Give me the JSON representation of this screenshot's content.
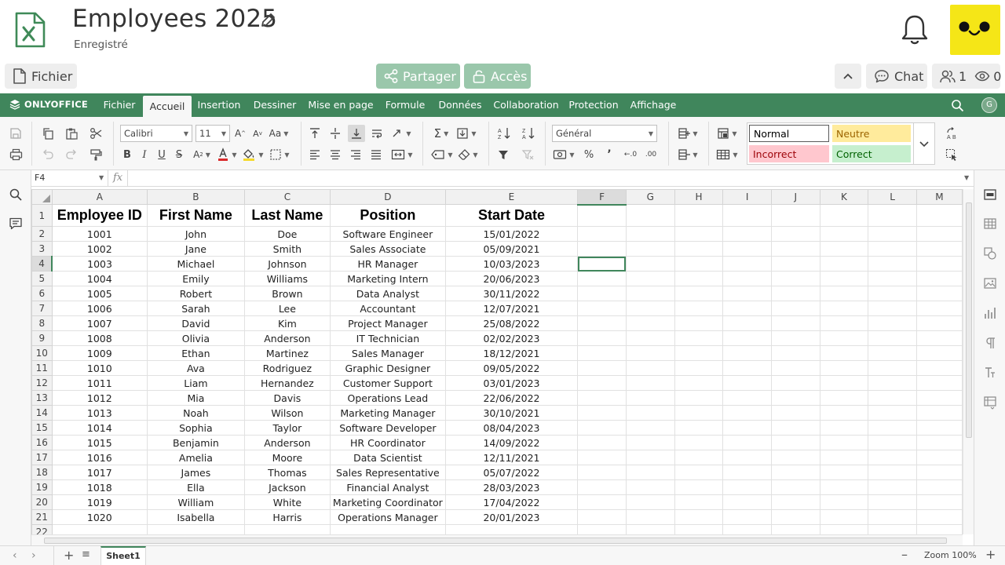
{
  "header": {
    "title": "Employees 2025",
    "saved_status": "Enregistré",
    "file_button": "Fichier",
    "share_button": "Partager",
    "access_button": "Accès",
    "chat_button": "Chat",
    "users_count": "1",
    "viewers_count": "0"
  },
  "tabs": {
    "logo": "ONLYOFFICE",
    "items": [
      "Fichier",
      "Accueil",
      "Insertion",
      "Dessiner",
      "Mise en page",
      "Formule",
      "Données",
      "Collaboration",
      "Protection",
      "Affichage"
    ],
    "active": "Accueil",
    "user_initial": "G"
  },
  "toolbar": {
    "font_name": "Calibri",
    "font_size": "11",
    "number_format": "Général",
    "styles": {
      "normal": "Normal",
      "neutral": "Neutre",
      "bad": "Incorrect",
      "good": "Correct"
    },
    "style_colors": {
      "normal": "#ffffff",
      "neutral": "#ffeb9c",
      "bad": "#ffc7ce",
      "good": "#c6efce"
    },
    "font_color": "#d9292b",
    "fill_color": "#f5d92b"
  },
  "formula_bar": {
    "cell_ref": "F4",
    "fx": "fx",
    "content": ""
  },
  "grid": {
    "columns": [
      "A",
      "B",
      "C",
      "D",
      "E",
      "F",
      "G",
      "H",
      "I",
      "J",
      "K",
      "L",
      "M"
    ],
    "selected_cell": "F4",
    "header_row": [
      "Employee ID",
      "First Name",
      "Last Name",
      "Position",
      "Start Date"
    ],
    "rows": [
      [
        "1001",
        "John",
        "Doe",
        "Software Engineer",
        "15/01/2022"
      ],
      [
        "1002",
        "Jane",
        "Smith",
        "Sales Associate",
        "05/09/2021"
      ],
      [
        "1003",
        "Michael",
        "Johnson",
        "HR Manager",
        "10/03/2023"
      ],
      [
        "1004",
        "Emily",
        "Williams",
        "Marketing Intern",
        "20/06/2023"
      ],
      [
        "1005",
        "Robert",
        "Brown",
        "Data Analyst",
        "30/11/2022"
      ],
      [
        "1006",
        "Sarah",
        "Lee",
        "Accountant",
        "12/07/2021"
      ],
      [
        "1007",
        "David",
        "Kim",
        "Project Manager",
        "25/08/2022"
      ],
      [
        "1008",
        "Olivia",
        "Anderson",
        "IT Technician",
        "02/02/2023"
      ],
      [
        "1009",
        "Ethan",
        "Martinez",
        "Sales Manager",
        "18/12/2021"
      ],
      [
        "1010",
        "Ava",
        "Rodriguez",
        "Graphic Designer",
        "09/05/2022"
      ],
      [
        "1011",
        "Liam",
        "Hernandez",
        "Customer Support",
        "03/01/2023"
      ],
      [
        "1012",
        "Mia",
        "Davis",
        "Operations Lead",
        "22/06/2022"
      ],
      [
        "1013",
        "Noah",
        "Wilson",
        "Marketing Manager",
        "30/10/2021"
      ],
      [
        "1014",
        "Sophia",
        "Taylor",
        "Software Developer",
        "08/04/2023"
      ],
      [
        "1015",
        "Benjamin",
        "Anderson",
        "HR Coordinator",
        "14/09/2022"
      ],
      [
        "1016",
        "Amelia",
        "Moore",
        "Data Scientist",
        "12/11/2021"
      ],
      [
        "1017",
        "James",
        "Thomas",
        "Sales Representative",
        "05/07/2022"
      ],
      [
        "1018",
        "Ella",
        "Jackson",
        "Financial Analyst",
        "28/03/2023"
      ],
      [
        "1019",
        "William",
        "White",
        "Marketing Coordinator",
        "17/04/2022"
      ],
      [
        "1020",
        "Isabella",
        "Harris",
        "Operations Manager",
        "20/01/2023"
      ]
    ],
    "row_numbers": [
      "1",
      "2",
      "3",
      "4",
      "5",
      "6",
      "7",
      "8",
      "9",
      "10",
      "11",
      "12",
      "13",
      "14",
      "15",
      "16",
      "17",
      "18",
      "19",
      "20",
      "21",
      "22"
    ]
  },
  "statusbar": {
    "sheet_name": "Sheet1",
    "zoom": "Zoom 100%"
  },
  "colors": {
    "brand": "#40865c",
    "share_button": "#9ac7ab",
    "avatar": "#f5e617"
  }
}
